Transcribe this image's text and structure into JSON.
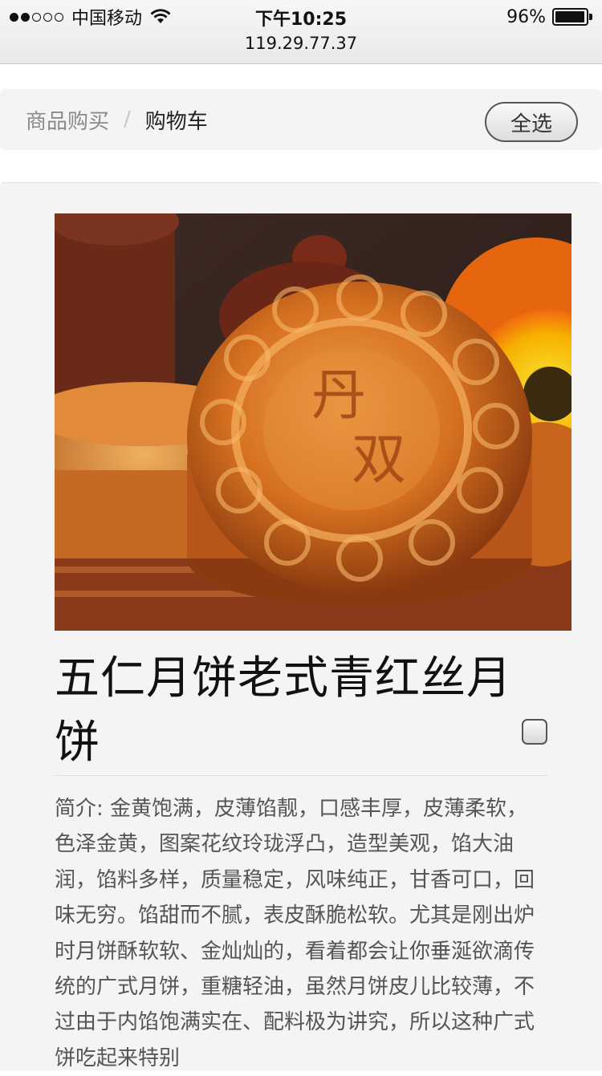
{
  "status_bar": {
    "carrier": "中国移动",
    "time": "下午10:25",
    "url": "119.29.77.37",
    "battery": "96%",
    "battery_level": 0.96,
    "signal_bars_filled": 2,
    "signal_bars_total": 5
  },
  "breadcrumb": {
    "parent": "商品购买",
    "separator": "/",
    "current": "购物车"
  },
  "toolbar": {
    "select_all_label": "全选"
  },
  "product": {
    "title": "五仁月饼老式青红丝月饼",
    "checked": false,
    "image_icon": "mooncake-photo",
    "description": "简介: 金黄饱满，皮薄馅靓，口感丰厚，皮薄柔软，色泽金黄，图案花纹玲珑浮凸，造型美观，馅大油润，馅料多样，质量稳定，风味纯正，甘香可口，回味无穷。馅甜而不腻，表皮酥脆松软。尤其是刚出炉时月饼酥软软、金灿灿的，看着都会让你垂涎欲滴传统的广式月饼，重糖轻油，虽然月饼皮儿比较薄，不过由于内馅饱满实在、配料极为讲究，所以这种广式饼吃起来特别"
  }
}
